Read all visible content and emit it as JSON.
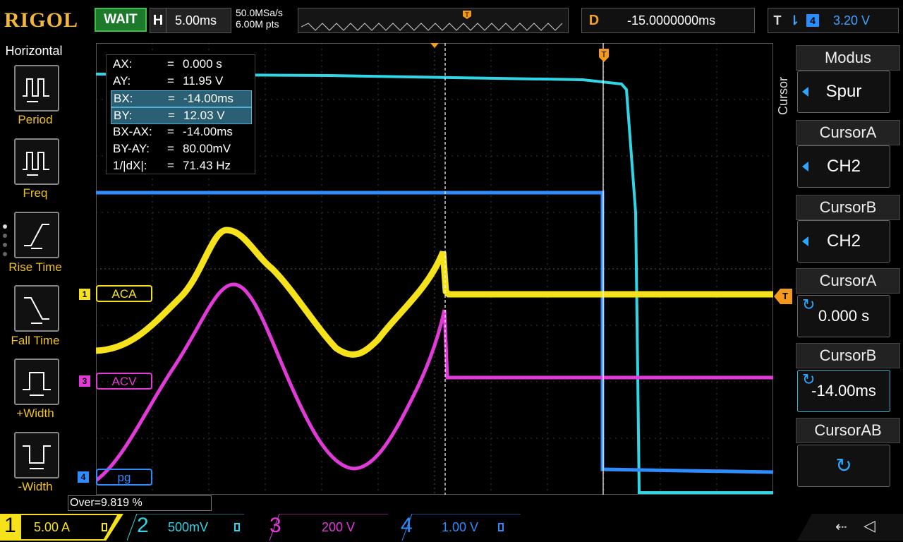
{
  "top": {
    "brand": "RIGOL",
    "run_state": "WAIT",
    "horizontal": {
      "label": "H",
      "value": "5.00ms"
    },
    "sample_rate": "50.0MSa/s",
    "memory_depth": "6.00M pts",
    "delay": {
      "label": "D",
      "value": "-15.0000000ms"
    },
    "trigger": {
      "label": "T",
      "source": "4",
      "level": "3.20 V"
    }
  },
  "left_menu": {
    "title": "Horizontal",
    "items": [
      {
        "label": "Period",
        "icon": "period-icon"
      },
      {
        "label": "Freq",
        "icon": "freq-icon"
      },
      {
        "label": "Rise Time",
        "icon": "rise-time-icon"
      },
      {
        "label": "Fall Time",
        "icon": "fall-time-icon"
      },
      {
        "label": "+Width",
        "icon": "pos-width-icon"
      },
      {
        "label": "-Width",
        "icon": "neg-width-icon"
      }
    ]
  },
  "right_menu": {
    "side_title": "Cursor",
    "items": [
      {
        "title": "Modus",
        "value": "Spur"
      },
      {
        "title": "CursorA",
        "value": "CH2"
      },
      {
        "title": "CursorB",
        "value": "CH2"
      },
      {
        "title": "CursorA",
        "value": "0.000 s"
      },
      {
        "title": "CursorB",
        "value": "-14.00ms"
      },
      {
        "title": "CursorAB",
        "value": ""
      }
    ]
  },
  "cursor_readout": [
    {
      "key": "AX:",
      "eq": "=",
      "value": "0.000 s"
    },
    {
      "key": "AY:",
      "eq": "=",
      "value": "11.95 V"
    },
    {
      "key": "BX:",
      "eq": "=",
      "value": "-14.00ms"
    },
    {
      "key": "BY:",
      "eq": "=",
      "value": "12.03 V"
    },
    {
      "key": "BX-AX:",
      "eq": "=",
      "value": "-14.00ms"
    },
    {
      "key": "BY-AY:",
      "eq": "=",
      "value": "80.00mV"
    },
    {
      "key": "1/|dX|:",
      "eq": "=",
      "value": "71.43 Hz"
    }
  ],
  "channel_labels": {
    "ch1": "ACA",
    "ch3": "ACV",
    "ch4": "pg"
  },
  "channel_markers": {
    "ch1": "1",
    "ch3": "3",
    "ch4": "4"
  },
  "measurement": "Over=9.819 %",
  "channels": [
    {
      "num": "1",
      "scale": "5.00 A",
      "color": "#f5e21a"
    },
    {
      "num": "2",
      "scale": "500mV",
      "color": "#31d6e6"
    },
    {
      "num": "3",
      "scale": "200 V",
      "color": "#e13ad8"
    },
    {
      "num": "4",
      "scale": "1.00 V",
      "color": "#2e8cff"
    }
  ],
  "colors": {
    "ch1": "#f5e21a",
    "ch2": "#31d6e6",
    "ch3": "#e13ad8",
    "ch4": "#2e8cff",
    "trigger": "#f39a1e"
  }
}
